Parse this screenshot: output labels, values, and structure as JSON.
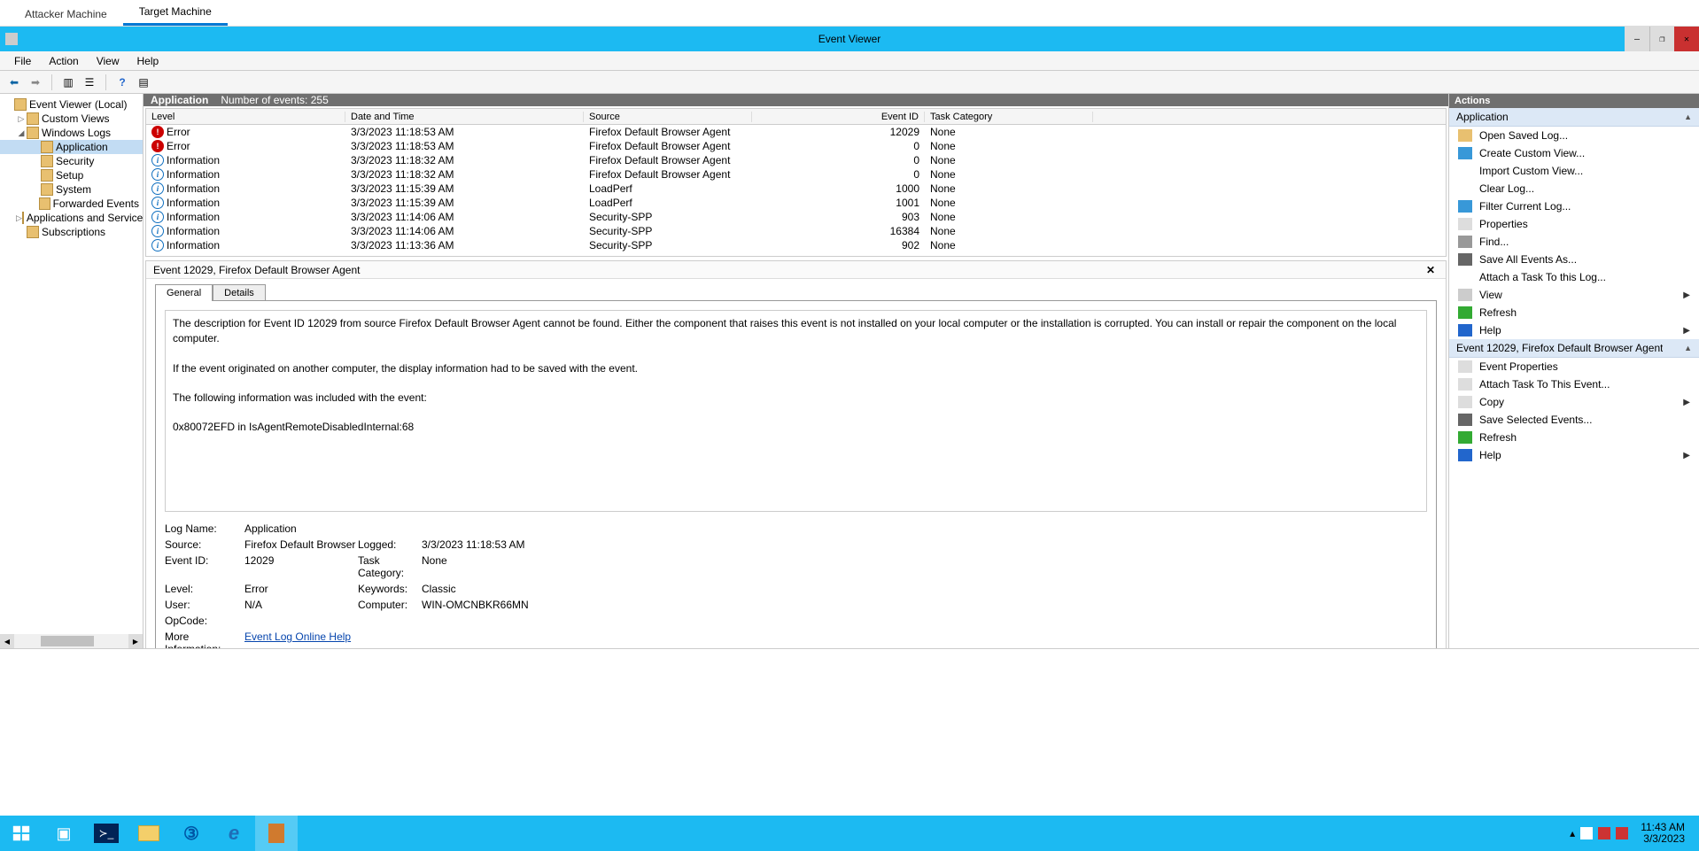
{
  "vm_tabs": {
    "attacker": "Attacker Machine",
    "target": "Target Machine",
    "active": "target"
  },
  "window": {
    "title": "Event Viewer"
  },
  "menu": {
    "file": "File",
    "action": "Action",
    "view": "View",
    "help": "Help"
  },
  "tree": {
    "root": "Event Viewer (Local)",
    "custom_views": "Custom Views",
    "windows_logs": "Windows Logs",
    "application": "Application",
    "security": "Security",
    "setup": "Setup",
    "system": "System",
    "forwarded": "Forwarded Events",
    "apps_services": "Applications and Services Lo",
    "subscriptions": "Subscriptions"
  },
  "center_header": {
    "name": "Application",
    "count": "Number of events: 255"
  },
  "columns": {
    "level": "Level",
    "date": "Date and Time",
    "source": "Source",
    "eid": "Event ID",
    "cat": "Task Category"
  },
  "events": [
    {
      "level": "Error",
      "lvl": "err",
      "date": "3/3/2023 11:18:53 AM",
      "source": "Firefox Default Browser Agent",
      "eid": "12029",
      "cat": "None"
    },
    {
      "level": "Error",
      "lvl": "err",
      "date": "3/3/2023 11:18:53 AM",
      "source": "Firefox Default Browser Agent",
      "eid": "0",
      "cat": "None"
    },
    {
      "level": "Information",
      "lvl": "info",
      "date": "3/3/2023 11:18:32 AM",
      "source": "Firefox Default Browser Agent",
      "eid": "0",
      "cat": "None"
    },
    {
      "level": "Information",
      "lvl": "info",
      "date": "3/3/2023 11:18:32 AM",
      "source": "Firefox Default Browser Agent",
      "eid": "0",
      "cat": "None"
    },
    {
      "level": "Information",
      "lvl": "info",
      "date": "3/3/2023 11:15:39 AM",
      "source": "LoadPerf",
      "eid": "1000",
      "cat": "None"
    },
    {
      "level": "Information",
      "lvl": "info",
      "date": "3/3/2023 11:15:39 AM",
      "source": "LoadPerf",
      "eid": "1001",
      "cat": "None"
    },
    {
      "level": "Information",
      "lvl": "info",
      "date": "3/3/2023 11:14:06 AM",
      "source": "Security-SPP",
      "eid": "903",
      "cat": "None"
    },
    {
      "level": "Information",
      "lvl": "info",
      "date": "3/3/2023 11:14:06 AM",
      "source": "Security-SPP",
      "eid": "16384",
      "cat": "None"
    },
    {
      "level": "Information",
      "lvl": "info",
      "date": "3/3/2023 11:13:36 AM",
      "source": "Security-SPP",
      "eid": "902",
      "cat": "None"
    }
  ],
  "detail": {
    "title": "Event 12029, Firefox Default Browser Agent",
    "tab_general": "General",
    "tab_details": "Details",
    "desc_p1": "The description for Event ID 12029 from source Firefox Default Browser Agent cannot be found. Either the component that raises this event is not installed on your local computer or the installation is corrupted. You can install or repair the component on the local computer.",
    "desc_p2": "If the event originated on another computer, the display information had to be saved with the event.",
    "desc_p3": "The following information was included with the event:",
    "desc_p4": "0x80072EFD in IsAgentRemoteDisabledInternal:68",
    "labels": {
      "log_name": "Log Name:",
      "source": "Source:",
      "event_id": "Event ID:",
      "level": "Level:",
      "user": "User:",
      "opcode": "OpCode:",
      "more_info": "More Information:",
      "logged": "Logged:",
      "task_category": "Task Category:",
      "keywords": "Keywords:",
      "computer": "Computer:"
    },
    "values": {
      "log_name": "Application",
      "source": "Firefox Default Browser Agen",
      "event_id": "12029",
      "level": "Error",
      "user": "N/A",
      "opcode": "",
      "logged": "3/3/2023 11:18:53 AM",
      "task_category": "None",
      "keywords": "Classic",
      "computer": "WIN-OMCNBKR66MN",
      "more_info_link": "Event Log Online Help"
    }
  },
  "actions": {
    "title": "Actions",
    "section_app": "Application",
    "section_event": "Event 12029, Firefox Default Browser Agent",
    "open_saved": "Open Saved Log...",
    "create_custom": "Create Custom View...",
    "import_custom": "Import Custom View...",
    "clear_log": "Clear Log...",
    "filter_current": "Filter Current Log...",
    "properties": "Properties",
    "find": "Find...",
    "save_all": "Save All Events As...",
    "attach_task_log": "Attach a Task To this Log...",
    "view": "View",
    "refresh": "Refresh",
    "help": "Help",
    "event_properties": "Event Properties",
    "attach_task_event": "Attach Task To This Event...",
    "copy": "Copy",
    "save_selected": "Save Selected Events...",
    "refresh2": "Refresh",
    "help2": "Help"
  },
  "taskbar": {
    "time": "11:43 AM",
    "date": "3/3/2023"
  }
}
